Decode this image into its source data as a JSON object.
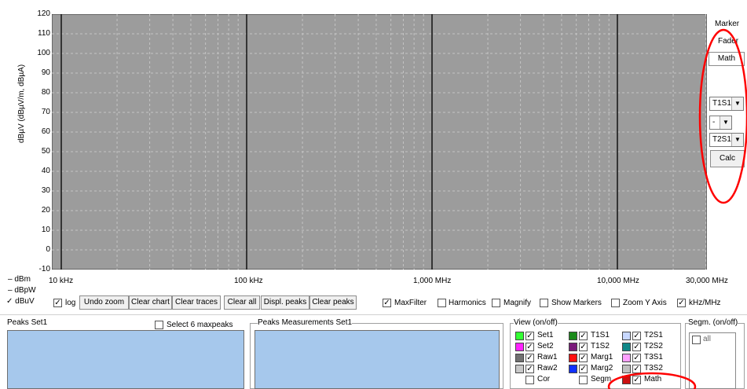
{
  "chart": {
    "y_label": "dBµV (dBµV/m, dBµA)",
    "y_ticks": [
      "120",
      "110",
      "100",
      "90",
      "80",
      "70",
      "60",
      "50",
      "40",
      "30",
      "20",
      "10",
      "0",
      "-10"
    ],
    "x_ticks": [
      "10 kHz",
      "100 kHz",
      "1,000 MHz",
      "10,000 MHz",
      "30,000 MHz"
    ]
  },
  "chart_data": {
    "type": "line",
    "series": [],
    "ylim": [
      -10,
      120
    ],
    "xlim": [
      "10 kHz",
      "30,000 MHz"
    ],
    "x_scale": "log",
    "grid": true
  },
  "units": [
    {
      "label": "dBm",
      "checked": false
    },
    {
      "label": "dBpW",
      "checked": false
    },
    {
      "label": "dBuV",
      "checked": true
    }
  ],
  "toolbar": {
    "log_label": "log",
    "log_checked": true,
    "buttons": [
      "Undo zoom",
      "Clear chart",
      "Clear traces",
      "Clear all",
      "Displ. peaks",
      "Clear peaks"
    ],
    "options": [
      {
        "label": "MaxFilter",
        "checked": true
      },
      {
        "label": "Harmonics",
        "checked": false
      },
      {
        "label": "Magnify",
        "checked": false
      },
      {
        "label": "Show Markers",
        "checked": false
      },
      {
        "label": "Zoom Y Axis",
        "checked": false
      },
      {
        "label": "kHz/MHz",
        "checked": true
      }
    ]
  },
  "right_panel": {
    "marker": "Marker",
    "fader": "Fader",
    "math": "Math",
    "sel1": "T1S1",
    "sel_op": "-",
    "sel2": "T2S1",
    "calc": "Calc"
  },
  "peaks_set": {
    "title": "Peaks Set1",
    "select_label": "Select 6 maxpeaks"
  },
  "peaks_meas": {
    "title": "Peaks Measurements Set1"
  },
  "view": {
    "title": "View (on/off)",
    "items": [
      {
        "label": "Set1",
        "color": "#33ff33",
        "checked": true
      },
      {
        "label": "T1S1",
        "color": "#1a8a1a",
        "checked": true
      },
      {
        "label": "T2S1",
        "color": "#c8d8ff",
        "checked": true
      },
      {
        "label": "Set2",
        "color": "#ff22ff",
        "checked": true
      },
      {
        "label": "T1S2",
        "color": "#7a1a7a",
        "checked": true
      },
      {
        "label": "T2S2",
        "color": "#108888",
        "checked": true
      },
      {
        "label": "Raw1",
        "color": "#707070",
        "checked": true
      },
      {
        "label": "Marg1",
        "color": "#ff1010",
        "checked": true
      },
      {
        "label": "T3S1",
        "color": "#ffa0ff",
        "checked": true
      },
      {
        "label": "Raw2",
        "color": "#c8c8c8",
        "checked": true
      },
      {
        "label": "Marg2",
        "color": "#1030ff",
        "checked": true
      },
      {
        "label": "T3S2",
        "color": "#c0c0c0",
        "checked": true
      },
      {
        "label": "Cor",
        "color": "",
        "checked": false
      },
      {
        "label": "Segm.",
        "color": "",
        "checked": false
      },
      {
        "label": "Math",
        "color": "#cc1010",
        "checked": true
      }
    ]
  },
  "segm": {
    "title": "Segm. (on/off)",
    "all": "all"
  },
  "colors": {
    "plot_bg": "#9c9c9c",
    "grid": "#c4c4c4",
    "major": "#111111",
    "list_bg": "#a6c8ec",
    "annotation": "#ff0000"
  }
}
